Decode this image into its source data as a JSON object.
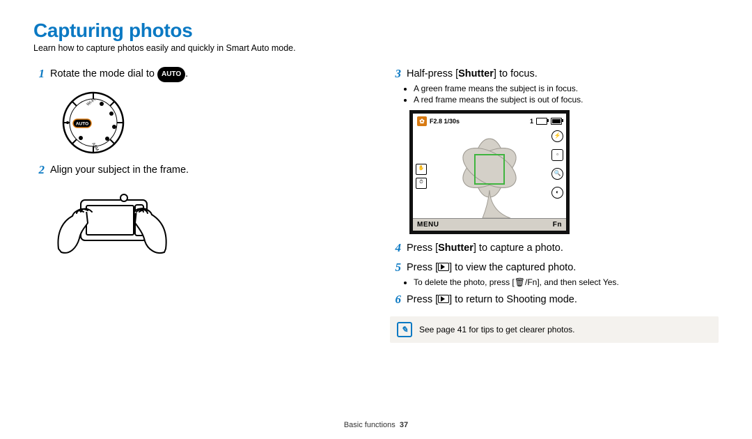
{
  "title": "Capturing photos",
  "subtitle": "Learn how to capture photos easily and quickly in Smart Auto mode.",
  "auto_label": "AUTO",
  "steps": {
    "s1": {
      "n": "1",
      "pre": "Rotate the mode dial to ",
      "post": "."
    },
    "s2": {
      "n": "2",
      "text": "Align your subject in the frame."
    },
    "s3": {
      "n": "3",
      "pre": "Half-press [",
      "btn": "Shutter",
      "post": "] to focus.",
      "b1": "A green frame means the subject is in focus.",
      "b2": "A red frame means the subject is out of focus."
    },
    "s4": {
      "n": "4",
      "pre": "Press [",
      "btn": "Shutter",
      "post": "] to capture a photo."
    },
    "s5": {
      "n": "5",
      "pre": "Press [",
      "post": "] to view the captured photo.",
      "b1_pre": "To delete the photo, press [",
      "b1_icon": "🗑/Fn",
      "b1_mid": "], and then select ",
      "b1_bold": "Yes",
      "b1_end": "."
    },
    "s6": {
      "n": "6",
      "pre": "Press [",
      "post": "] to return to Shooting mode."
    }
  },
  "lcd": {
    "exposure": "F2.8 1/30s",
    "count": "1",
    "menu": "MENU",
    "fn": "Fn"
  },
  "dial_modes": {
    "wifi": "Wi-Fi",
    "asm": "ASM"
  },
  "tip": "See page 41 for tips to get clearer photos.",
  "footer": {
    "section": "Basic functions",
    "page": "37"
  }
}
